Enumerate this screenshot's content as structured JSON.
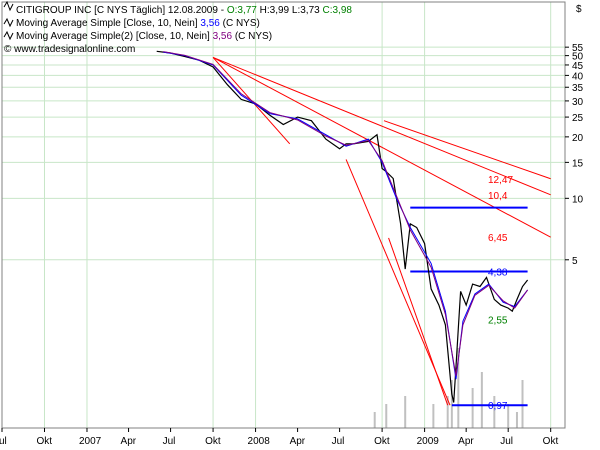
{
  "legend": {
    "line1": {
      "text": "CITIGROUP INC [C NYS  Täglich] 12.08.2009 - ",
      "open": "O:3,77",
      "high": "H:3,99",
      "low": "L:3,73",
      "close": "C:3,98"
    },
    "line2": {
      "text": "Moving Average Simple [Close, 10, Nein] ",
      "value": "3,56",
      "suffix": " (C NYS)"
    },
    "line3": {
      "text": "Moving Average Simple(2) [Close, 10, Nein] ",
      "value": "3,56",
      "suffix": " (C NYS)"
    }
  },
  "watermark": "© www.tradesignalonline.com",
  "currency_symbol": "$",
  "colors": {
    "background": "#ffffff",
    "grid": "#c8e6c8",
    "price": "#000000",
    "ma1": "#0000ff",
    "ma2": "#800080",
    "trendline": "#ff0000",
    "level_line": "#0000ff",
    "volume": "#c0c0c0",
    "green_text": "#008000"
  },
  "chart_data": {
    "type": "line",
    "title": "CITIGROUP INC [C NYS Täglich]",
    "xlabel": "",
    "ylabel": "",
    "y_scale": "log",
    "ylim": [
      0.75,
      57
    ],
    "xlim": [
      "2006-07-01",
      "2009-11-01"
    ],
    "y_ticks": [
      55,
      50,
      45,
      40,
      35,
      30,
      25,
      20,
      15,
      10,
      5
    ],
    "x_ticks": [
      {
        "label": "Jul",
        "date": "2006-07-01"
      },
      {
        "label": "Okt",
        "date": "2006-10-01"
      },
      {
        "label": "2007",
        "date": "2007-01-01"
      },
      {
        "label": "Apr",
        "date": "2007-04-01"
      },
      {
        "label": "Jul",
        "date": "2007-07-01"
      },
      {
        "label": "Okt",
        "date": "2007-10-01"
      },
      {
        "label": "2008",
        "date": "2008-01-01"
      },
      {
        "label": "Apr",
        "date": "2008-04-01"
      },
      {
        "label": "Jul",
        "date": "2008-07-01"
      },
      {
        "label": "Okt",
        "date": "2008-10-01"
      },
      {
        "label": "2009",
        "date": "2009-01-01"
      },
      {
        "label": "Apr",
        "date": "2009-04-01"
      },
      {
        "label": "Jul",
        "date": "2009-07-01"
      },
      {
        "label": "Okt",
        "date": "2009-10-01"
      }
    ],
    "grid": true,
    "series": [
      {
        "name": "CITIGROUP INC",
        "x": [
          "2007-06-01",
          "2007-07-01",
          "2007-07-15",
          "2007-08-01",
          "2007-09-01",
          "2007-10-01",
          "2007-11-01",
          "2007-12-01",
          "2008-01-01",
          "2008-02-01",
          "2008-03-01",
          "2008-04-01",
          "2008-05-01",
          "2008-06-01",
          "2008-07-01",
          "2008-07-15",
          "2008-08-01",
          "2008-09-01",
          "2008-09-20",
          "2008-10-01",
          "2008-10-10",
          "2008-10-25",
          "2008-11-10",
          "2008-11-20",
          "2008-12-01",
          "2008-12-15",
          "2009-01-01",
          "2009-01-15",
          "2009-02-01",
          "2009-02-15",
          "2009-03-01",
          "2009-03-05",
          "2009-03-10",
          "2009-03-15",
          "2009-03-20",
          "2009-04-01",
          "2009-04-15",
          "2009-05-01",
          "2009-05-15",
          "2009-06-01",
          "2009-06-15",
          "2009-07-01",
          "2009-07-10",
          "2009-07-20",
          "2009-08-01",
          "2009-08-12"
        ],
        "values": [
          52.5,
          51.5,
          50.5,
          49.5,
          47.5,
          44.0,
          36.0,
          30.5,
          29.0,
          25.5,
          23.0,
          25.0,
          24.0,
          19.5,
          17.5,
          18.5,
          18.5,
          19.0,
          20.5,
          14.0,
          13.5,
          12.5,
          7.5,
          4.5,
          7.5,
          7.2,
          6.0,
          3.6,
          3.0,
          2.4,
          1.1,
          1.0,
          1.5,
          2.3,
          3.5,
          3.0,
          3.8,
          3.7,
          4.1,
          3.2,
          3.0,
          2.9,
          2.8,
          3.2,
          3.7,
          3.98
        ]
      },
      {
        "name": "Moving Average Simple [Close, 10, Nein]",
        "x": [
          "2007-06-15",
          "2007-08-01",
          "2007-10-01",
          "2007-12-01",
          "2008-02-01",
          "2008-04-01",
          "2008-06-01",
          "2008-07-15",
          "2008-09-01",
          "2008-10-01",
          "2008-11-01",
          "2008-12-01",
          "2009-01-15",
          "2009-02-15",
          "2009-03-10",
          "2009-03-25",
          "2009-04-20",
          "2009-05-20",
          "2009-06-20",
          "2009-07-15",
          "2009-08-12"
        ],
        "values": [
          52,
          50,
          45,
          32,
          26,
          24.5,
          20.5,
          18,
          19.5,
          15,
          10,
          7.2,
          4.8,
          2.8,
          1.3,
          2.5,
          3.4,
          3.8,
          3.1,
          2.95,
          3.56
        ]
      },
      {
        "name": "Moving Average Simple(2) [Close, 10, Nein]",
        "x": [
          "2007-06-15",
          "2007-08-01",
          "2007-10-01",
          "2007-12-01",
          "2008-02-01",
          "2008-04-01",
          "2008-06-01",
          "2008-07-15",
          "2008-09-01",
          "2008-10-01",
          "2008-11-01",
          "2008-12-01",
          "2009-01-15",
          "2009-02-15",
          "2009-03-10",
          "2009-03-25",
          "2009-04-20",
          "2009-05-20",
          "2009-06-20",
          "2009-07-15",
          "2009-08-12"
        ],
        "values": [
          52.3,
          50.2,
          45.3,
          32.5,
          26.3,
          24.2,
          20.2,
          18.2,
          19.2,
          15.3,
          10.3,
          7.0,
          4.6,
          2.7,
          1.35,
          2.4,
          3.35,
          3.75,
          3.15,
          2.9,
          3.56
        ]
      }
    ],
    "volume": {
      "note": "volume bars without printed values",
      "x": [
        "2008-09-15",
        "2008-10-10",
        "2008-11-20",
        "2009-01-20",
        "2009-02-20",
        "2009-03-01",
        "2009-03-15",
        "2009-04-15",
        "2009-05-05",
        "2009-06-01",
        "2009-07-01",
        "2009-07-20",
        "2009-08-01"
      ],
      "values": [
        2,
        3,
        4,
        3,
        4,
        6,
        10,
        5,
        7,
        4,
        3,
        2,
        6
      ]
    },
    "trendlines": [
      {
        "x": [
          "2007-10-01",
          "2009-10-01"
        ],
        "y": [
          49,
          10.4
        ]
      },
      {
        "x": [
          "2007-10-01",
          "2009-10-01"
        ],
        "y": [
          49,
          6.45
        ]
      },
      {
        "x": [
          "2008-10-05",
          "2009-10-01"
        ],
        "y": [
          24,
          12.47
        ]
      },
      {
        "x": [
          "2007-10-01",
          "2008-03-15"
        ],
        "y": [
          49,
          18.5
        ]
      },
      {
        "x": [
          "2008-07-15",
          "2009-02-25"
        ],
        "y": [
          15.5,
          0.97
        ]
      },
      {
        "x": [
          "2008-10-15",
          "2009-02-20"
        ],
        "y": [
          6.4,
          0.97
        ]
      }
    ],
    "levels": [
      {
        "label": "9",
        "value": 9,
        "from": "2008-12-01",
        "to": "2009-08-12",
        "color": "#0000ff"
      },
      {
        "label": "4,38",
        "value": 4.38,
        "from": "2008-12-01",
        "to": "2009-08-12",
        "color": "#0000ff"
      },
      {
        "label": "0,97",
        "value": 0.97,
        "from": "2009-03-01",
        "to": "2009-08-12",
        "color": "#0000ff"
      }
    ],
    "annotations": [
      {
        "label": "12,47",
        "value": 12.47,
        "color": "#ff0000"
      },
      {
        "label": "10,4",
        "value": 10.4,
        "color": "#ff0000"
      },
      {
        "label": "6,45",
        "value": 6.45,
        "color": "#ff0000"
      },
      {
        "label": "4,38",
        "value": 4.38,
        "color": "#0000ff"
      },
      {
        "label": "2,55",
        "value": 2.55,
        "color": "#008000"
      },
      {
        "label": "0,97",
        "value": 0.97,
        "color": "#0000ff"
      }
    ]
  }
}
